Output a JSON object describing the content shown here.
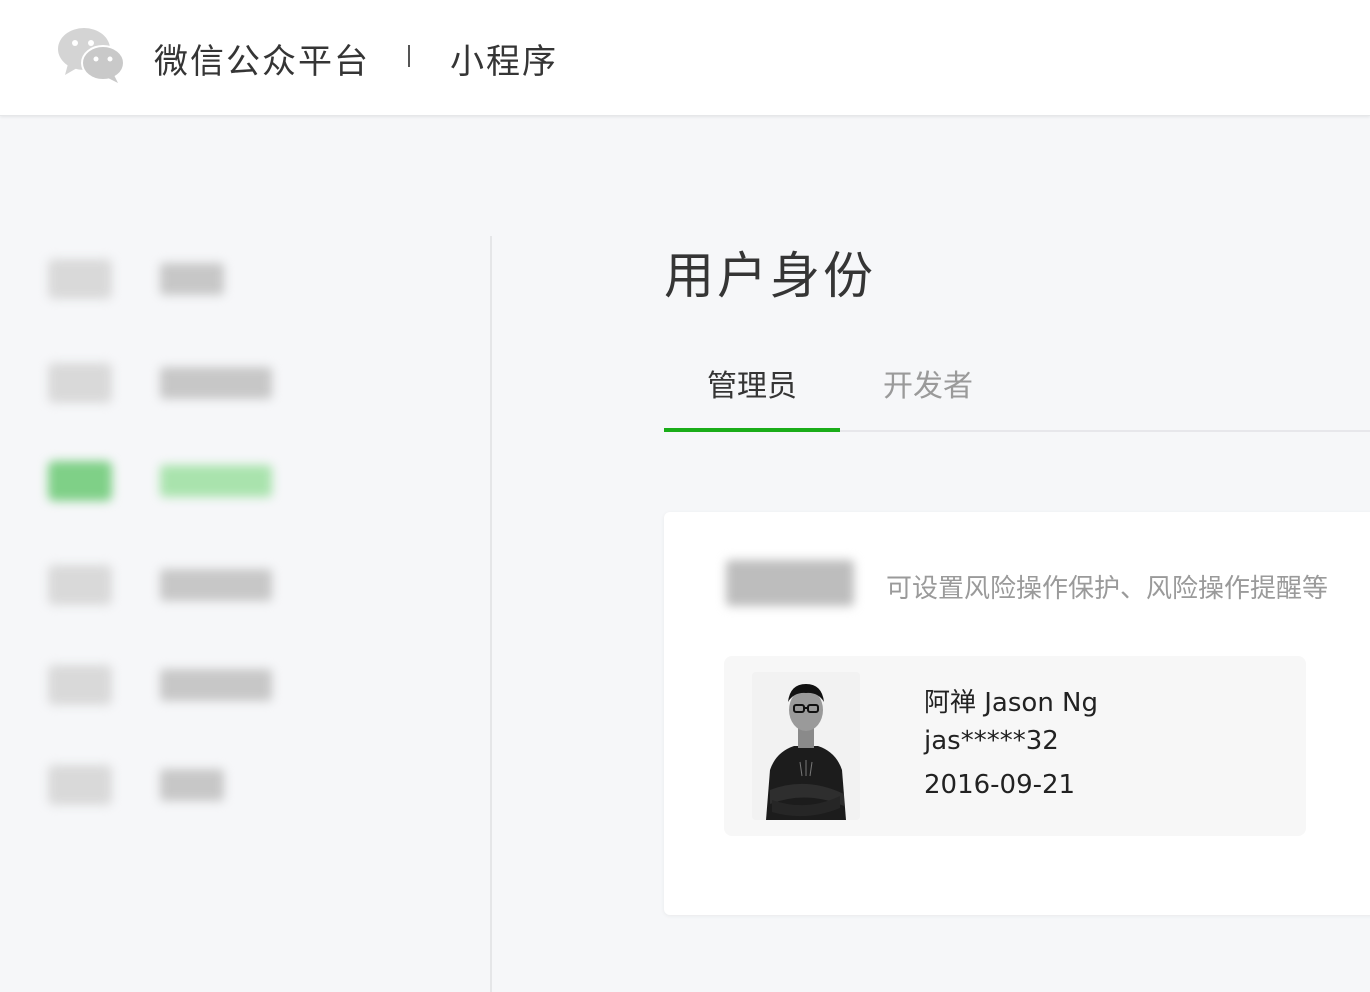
{
  "header": {
    "brand_title": "微信公众平台",
    "separator": "|",
    "product": "小程序",
    "logo_icon": "wechat-logo-icon"
  },
  "sidebar": {
    "note": "",
    "items": [
      {
        "label": "",
        "icon": "blurred-icon",
        "active": false
      },
      {
        "label": "",
        "icon": "blurred-icon",
        "active": false
      },
      {
        "label": "",
        "icon": "blurred-icon",
        "active": true
      },
      {
        "label": "",
        "icon": "blurred-icon",
        "active": false
      },
      {
        "label": "",
        "icon": "blurred-icon",
        "active": false
      },
      {
        "label": "",
        "icon": "blurred-icon",
        "active": false
      }
    ]
  },
  "main": {
    "page_title": "用户身份",
    "tabs": [
      {
        "label": "管理员",
        "active": true
      },
      {
        "label": "开发者",
        "active": false
      }
    ],
    "card": {
      "label": "",
      "tip": "可设置风险操作保护、风险操作提醒等",
      "admin": {
        "name": "阿禅 Jason Ng",
        "account": "jas*****32",
        "date": "2016-09-21"
      }
    }
  },
  "colors": {
    "accent": "#1aad19",
    "text_primary": "#353535",
    "text_secondary": "#9a9a9a",
    "background": "#f6f7f9"
  }
}
